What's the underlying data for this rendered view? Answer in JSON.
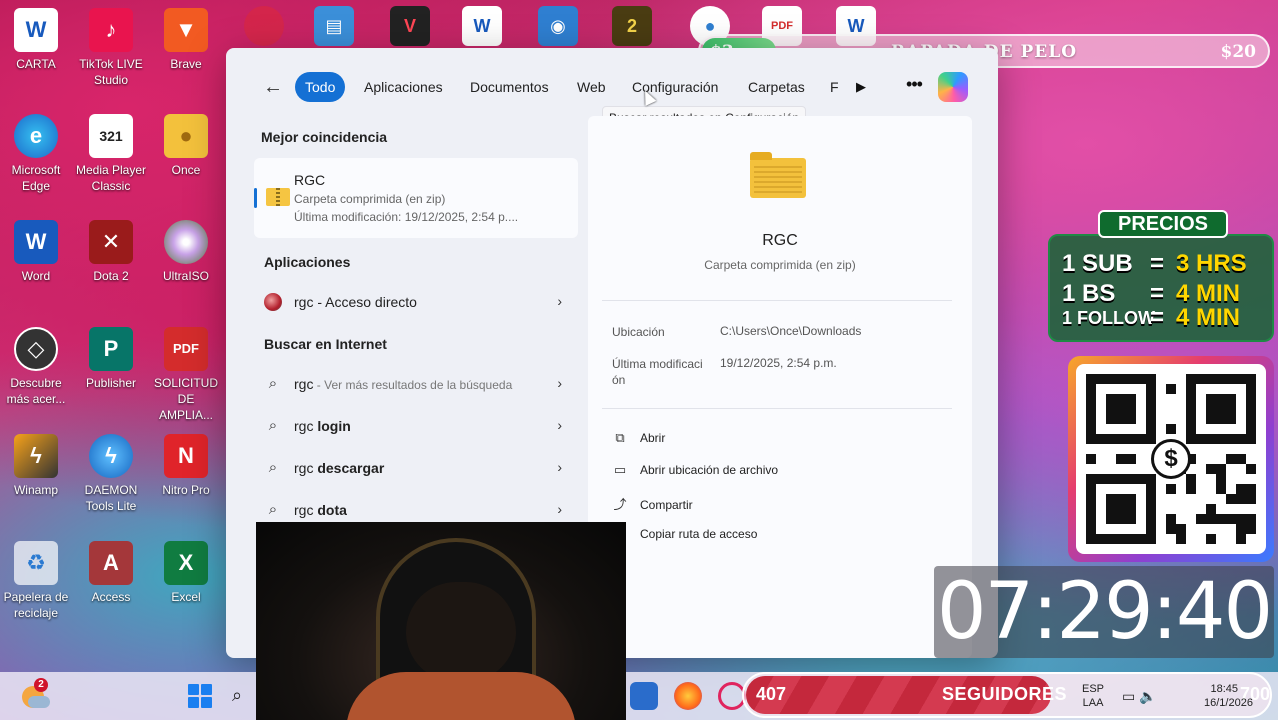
{
  "desktop": {
    "icons": [
      {
        "label": "CARTA",
        "icon": "word-document-icon"
      },
      {
        "label": "TikTok LIVE Studio",
        "icon": "tiktok-icon"
      },
      {
        "label": "Brave",
        "icon": "brave-lion-icon"
      },
      {
        "label": "Microsoft Edge",
        "icon": "edge-icon"
      },
      {
        "label": "Media Player Classic",
        "icon": "media-player-icon"
      },
      {
        "label": "Once",
        "icon": "user-folder-icon"
      },
      {
        "label": "Word",
        "icon": "word-icon"
      },
      {
        "label": "Dota 2",
        "icon": "dota-icon"
      },
      {
        "label": "UltraISO",
        "icon": "disc-icon"
      },
      {
        "label": "Descubre más acer...",
        "icon": "compass-icon"
      },
      {
        "label": "Publisher",
        "icon": "publisher-icon"
      },
      {
        "label": "SOLICITUD DE AMPLIA...",
        "icon": "pdf-icon"
      },
      {
        "label": "Winamp",
        "icon": "winamp-icon"
      },
      {
        "label": "DAEMON Tools Lite",
        "icon": "daemon-tools-icon"
      },
      {
        "label": "Nitro Pro",
        "icon": "nitro-icon"
      },
      {
        "label": "Papelera de reciclaje",
        "icon": "recycle-bin-icon"
      },
      {
        "label": "Access",
        "icon": "access-icon"
      },
      {
        "label": "Excel",
        "icon": "excel-icon"
      }
    ]
  },
  "search": {
    "tabs": [
      "Todo",
      "Aplicaciones",
      "Documentos",
      "Web",
      "Configuración",
      "Carpetas",
      "F"
    ],
    "tooltip": "Buscar resultados en Configuración",
    "best_match_title": "Mejor coincidencia",
    "best_match": {
      "name": "RGC",
      "type": "Carpeta comprimida (en zip)",
      "modified": "Última modificación: 19/12/2025, 2:54 p...."
    },
    "apps_title": "Aplicaciones",
    "apps": [
      {
        "label": "rgc - Acceso directo"
      }
    ],
    "web_title": "Buscar en Internet",
    "web_results": [
      {
        "query": "rgc",
        "hint": " - Ver más resultados de la búsqueda"
      },
      {
        "query": "rgc ",
        "bold": "login"
      },
      {
        "query": "rgc ",
        "bold": "descargar"
      },
      {
        "query": "rgc ",
        "bold": "dota"
      }
    ],
    "preview": {
      "title": "RGC",
      "subtitle": "Carpeta comprimida (en zip)",
      "location_label": "Ubicación",
      "location_value": "C:\\Users\\Once\\Downloads",
      "modified_label": "Última modificaci ón",
      "modified_value": "19/12/2025, 2:54 p.m.",
      "actions": [
        {
          "label": "Abrir",
          "icon": "open-external-icon"
        },
        {
          "label": "Abrir ubicación de archivo",
          "icon": "folder-icon"
        },
        {
          "label": "Compartir",
          "icon": "share-icon"
        },
        {
          "label": "Copiar ruta de acceso",
          "icon": "copy-icon"
        }
      ]
    }
  },
  "overlays": {
    "goal": {
      "start": "$3",
      "title": "RAPADA DE PELO",
      "end": "$20",
      "progress": 0.13
    },
    "prices_title": "PRECIOS",
    "prices": [
      {
        "item": "1 SUB",
        "eq": "=",
        "value": "3 HRS"
      },
      {
        "item": "1 BS",
        "eq": "=",
        "value": "4 MIN"
      },
      {
        "item": "1 FOLLOW",
        "eq": "=",
        "value": "4 MIN"
      }
    ],
    "timer": "07:29:40",
    "followers": {
      "count": "407",
      "label": "SEGUIDORES",
      "goal": "700",
      "progress": 0.58
    }
  },
  "taskbar": {
    "weather_badge": "2",
    "lang_1": "ESP",
    "lang_2": "LAA",
    "time": "18:45",
    "date": "16/1/2026"
  },
  "colors": {
    "accent": "#1470d4",
    "goal_fill": "#3dbf6a",
    "follower_fill": "#c4283c",
    "prices_green": "#0f6b2e"
  }
}
